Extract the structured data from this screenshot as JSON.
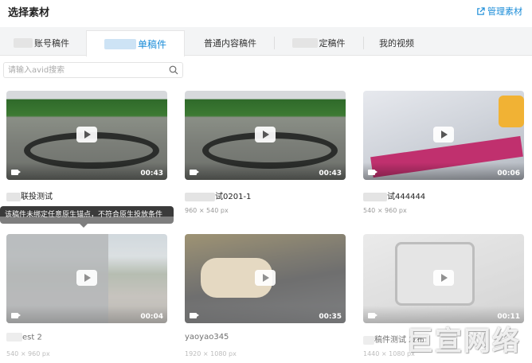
{
  "header": {
    "title": "选择素材",
    "manage_label": "管理素材"
  },
  "tabs": [
    {
      "label": "账号稿件"
    },
    {
      "label": "单稿件"
    },
    {
      "label": "普通内容稿件"
    },
    {
      "label": "定稿件"
    },
    {
      "label": "我的视频"
    }
  ],
  "search": {
    "placeholder": "请输入avid搜索"
  },
  "cards": [
    {
      "title": "联投测试",
      "meta": "",
      "duration": "00:43"
    },
    {
      "title": "试0201-1",
      "meta": "960 × 540 px",
      "duration": "00:43"
    },
    {
      "title": "试444444",
      "meta": "540 × 960 px",
      "duration": "00:06"
    },
    {
      "title": "est 2",
      "meta": "540 × 960 px",
      "duration": "00:04"
    },
    {
      "title": "yaoyao345",
      "meta": "1920 × 1080 px",
      "duration": "00:35"
    },
    {
      "title": "稿件测试 发布",
      "meta": "1440 × 1080 px",
      "duration": "00:11"
    }
  ],
  "tooltip": {
    "text": "该稿件未绑定任意原生锚点，不符合原生投放条件"
  },
  "watermark": {
    "text": "巨宣网络"
  },
  "colors": {
    "accent": "#1a8cd8",
    "tooltip_bg": "#3a3a3a"
  }
}
